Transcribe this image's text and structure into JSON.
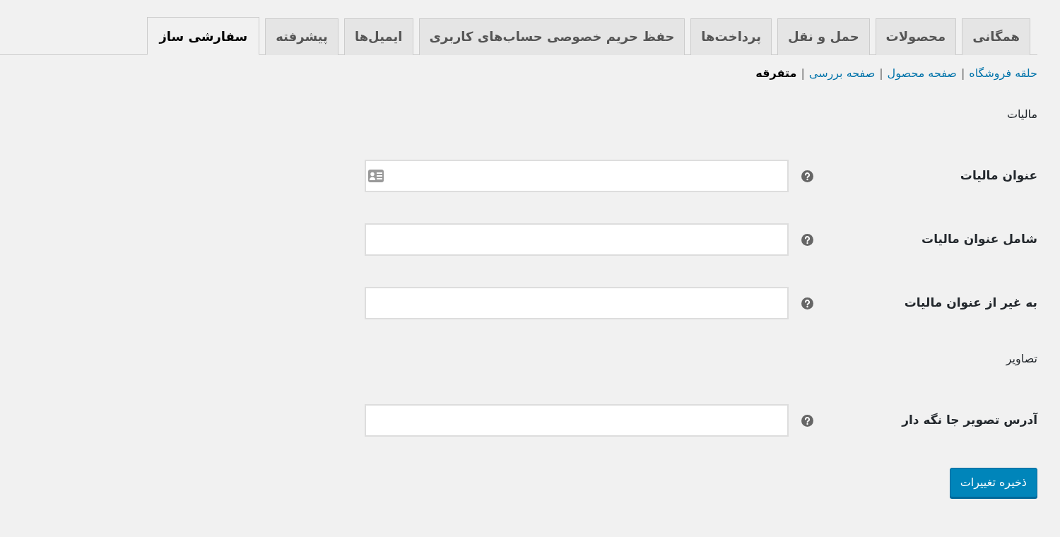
{
  "tabs": [
    {
      "label": "همگانی",
      "selected": false
    },
    {
      "label": "محصولات",
      "selected": false
    },
    {
      "label": "حمل و نقل",
      "selected": false
    },
    {
      "label": "پرداخت‌ها",
      "selected": false
    },
    {
      "label": "حفظ حریم خصوصی حساب‌های کاربری",
      "selected": false
    },
    {
      "label": "ایمیل‌ها",
      "selected": false
    },
    {
      "label": "پیشرفته",
      "selected": false
    },
    {
      "label": "سفارشی ساز",
      "selected": true
    }
  ],
  "subnav": [
    {
      "label": "حلقه فروشگاه",
      "selected": false,
      "separator": "|"
    },
    {
      "label": "صفحه محصول",
      "selected": false,
      "separator": "|"
    },
    {
      "label": "صفحه بررسی",
      "selected": false,
      "separator": "|"
    },
    {
      "label": "متفرقه",
      "selected": true
    }
  ],
  "sections": [
    {
      "title": "مالیات",
      "fields": [
        {
          "label": "عنوان مالیات",
          "autofill_icon": true
        },
        {
          "label": "شامل عنوان مالیات",
          "autofill_icon": false
        },
        {
          "label": "به غیر از عنوان مالیات",
          "autofill_icon": false
        }
      ]
    },
    {
      "title": "تصاویر",
      "fields": [
        {
          "label": "آدرس تصویر جا نگه دار",
          "autofill_icon": false
        }
      ]
    }
  ],
  "save_button": "ذخیره تغییرات"
}
